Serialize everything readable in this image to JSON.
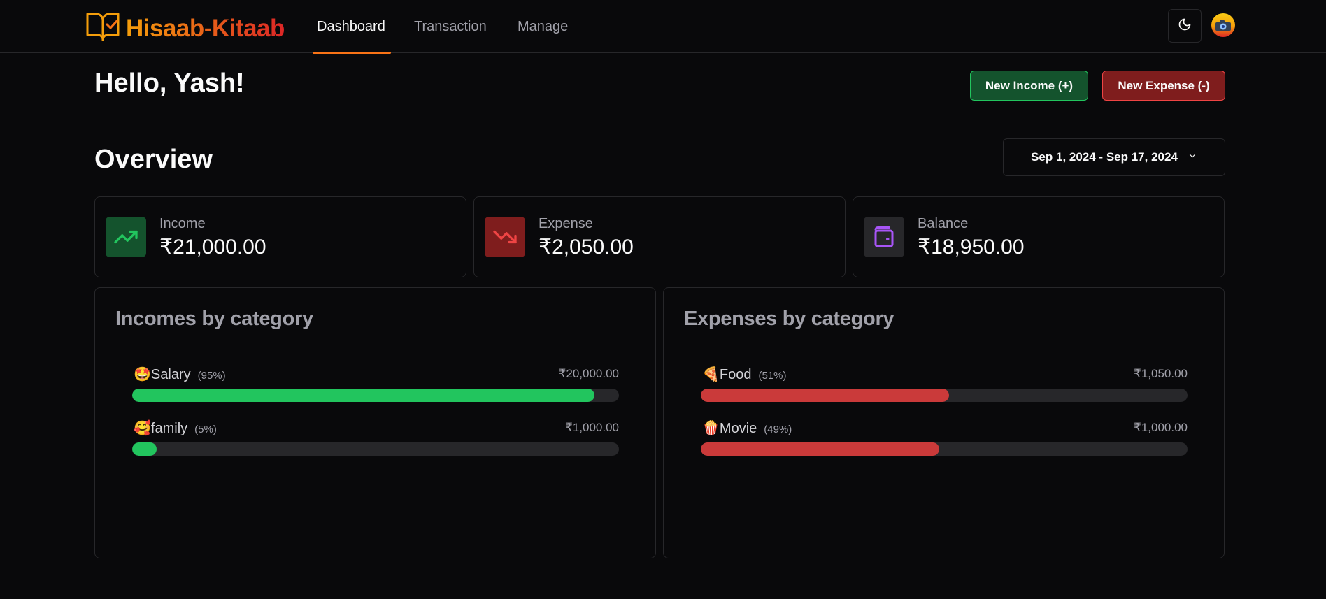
{
  "nav": {
    "app_name": "Hisaab-Kitaab",
    "links": [
      {
        "label": "Dashboard",
        "active": true
      },
      {
        "label": "Transaction",
        "active": false
      },
      {
        "label": "Manage",
        "active": false
      }
    ],
    "theme_icon": "moon-icon",
    "avatar_icon": "user-avatar"
  },
  "header": {
    "greeting": "Hello, Yash!",
    "new_income_label": "New Income (+)",
    "new_expense_label": "New Expense (-)"
  },
  "overview": {
    "title": "Overview",
    "date_range": "Sep 1, 2024 - Sep 17, 2024"
  },
  "stats": [
    {
      "label": "Income",
      "value": "₹21,000.00",
      "icon": "trending-up-icon",
      "color": "#22c55e"
    },
    {
      "label": "Expense",
      "value": "₹2,050.00",
      "icon": "trending-down-icon",
      "color": "#ef4444"
    },
    {
      "label": "Balance",
      "value": "₹18,950.00",
      "icon": "wallet-icon",
      "color": "#a855f7"
    }
  ],
  "incomes": {
    "title": "Incomes by category",
    "bar_color": "#22c55e",
    "items": [
      {
        "emoji": "🤩",
        "name": "Salary",
        "percent_label": "(95%)",
        "percent": 95,
        "amount": "₹20,000.00"
      },
      {
        "emoji": "🥰",
        "name": "family",
        "percent_label": "(5%)",
        "percent": 5,
        "amount": "₹1,000.00"
      }
    ]
  },
  "expenses": {
    "title": "Expenses by category",
    "bar_color": "#ca3a3a",
    "items": [
      {
        "emoji": "🍕",
        "name": "Food",
        "percent_label": "(51%)",
        "percent": 51,
        "amount": "₹1,050.00"
      },
      {
        "emoji": "🍿",
        "name": "Movie",
        "percent_label": "(49%)",
        "percent": 49,
        "amount": "₹1,000.00"
      }
    ]
  }
}
